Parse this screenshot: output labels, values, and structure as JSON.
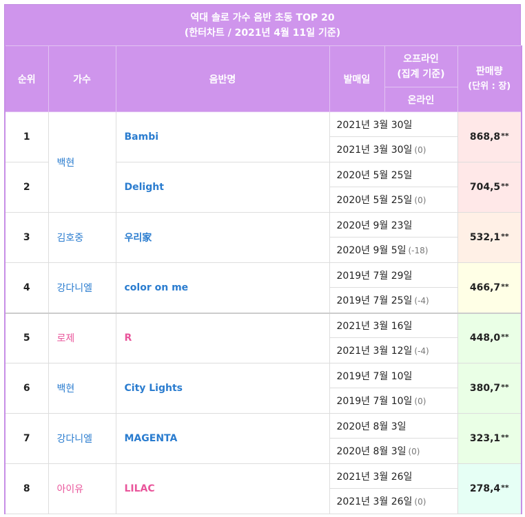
{
  "header": {
    "title_line1": "역대 솔로 가수 음반 초동 TOP 20",
    "title_line2": "(한터차트 / 2021년 4월 11일 기준)"
  },
  "columns": {
    "rank": "순위",
    "artist": "가수",
    "album": "음반명",
    "release": "발매일",
    "offline": "오프라인",
    "offline_note": "(집계 기준)",
    "online": "온라인",
    "sales": "판매량",
    "sales_unit": "(단위 : 장)"
  },
  "rows": [
    {
      "rank": "1",
      "artist": "백현",
      "album": "Bambi",
      "offline_date": "2021년 3월 30일",
      "online_date": "2021년 3월 30일",
      "diff": "(0)",
      "sales": "868,8",
      "mark": "**",
      "color": "#ffe8e8"
    },
    {
      "rank": "2",
      "artist": "",
      "album": "Delight",
      "offline_date": "2020년 5월 25일",
      "online_date": "2020년 5월 25일",
      "diff": "(0)",
      "sales": "704,5",
      "mark": "**",
      "color": "#ffe8e8"
    },
    {
      "rank": "3",
      "artist": "김호중",
      "album": "우리家",
      "offline_date": "2020년 9월 23일",
      "online_date": "2020년 9월 5일",
      "diff": "(-18)",
      "sales": "532,1",
      "mark": "**",
      "color": "#fff0e6"
    },
    {
      "rank": "4",
      "artist": "강다니엘",
      "album": "color on me",
      "offline_date": "2019년 7월 29일",
      "online_date": "2019년 7월 25일",
      "diff": "(-4)",
      "sales": "466,7",
      "mark": "**",
      "color": "#ffffe6"
    },
    {
      "rank": "5",
      "artist": "로제",
      "album": "R",
      "offline_date": "2021년 3월 16일",
      "online_date": "2021년 3월 12일",
      "diff": "(-4)",
      "sales": "448,0",
      "mark": "**",
      "color": "#eaffe6"
    },
    {
      "rank": "6",
      "artist": "백현",
      "album": "City Lights",
      "offline_date": "2019년 7월 10일",
      "online_date": "2019년 7월 10일",
      "diff": "(0)",
      "sales": "380,7",
      "mark": "**",
      "color": "#eaffe6"
    },
    {
      "rank": "7",
      "artist": "강다니엘",
      "album": "MAGENTA",
      "offline_date": "2020년 8월 3일",
      "online_date": "2020년 8월 3일",
      "diff": "(0)",
      "sales": "323,1",
      "mark": "**",
      "color": "#eaffe6"
    },
    {
      "rank": "8",
      "artist": "아이유",
      "album": "LILAC",
      "offline_date": "2021년 3월 26일",
      "online_date": "2021년 3월 26일",
      "diff": "(0)",
      "sales": "278,4",
      "mark": "**",
      "color": "#e6fff5"
    }
  ],
  "colors": {
    "header_bg": "#cf95ec",
    "male_text": "#2a7ccf",
    "female_text": "#e9559b"
  }
}
